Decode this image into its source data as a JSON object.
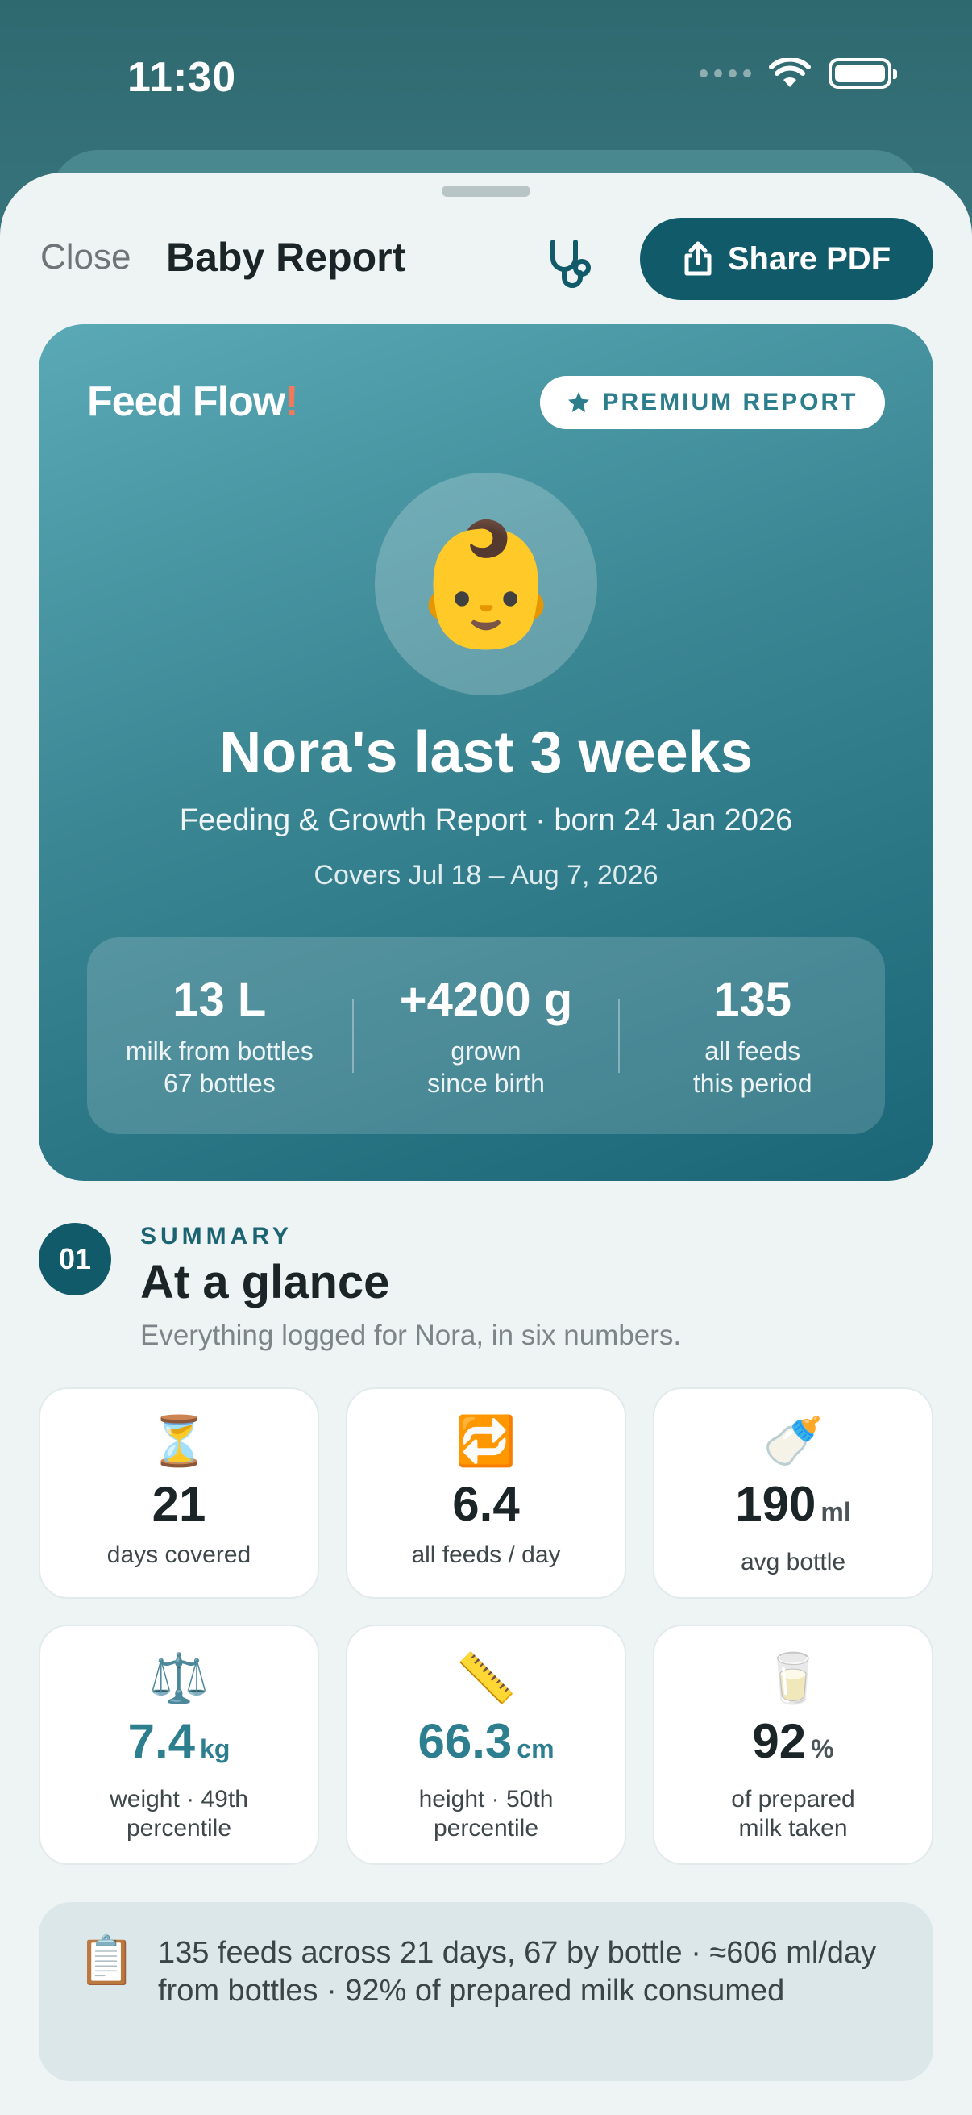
{
  "status_bar": {
    "time": "11:30"
  },
  "header": {
    "close_label": "Close",
    "title": "Baby Report",
    "share_label": "Share PDF"
  },
  "hero": {
    "brand": "Feed Flow",
    "brand_mark": "!",
    "badge": "PREMIUM REPORT",
    "avatar_emoji": "👶",
    "title": "Nora's last 3 weeks",
    "subtitle": "Feeding & Growth Report · born 24 Jan 2026",
    "covers": "Covers Jul 18 – Aug 7, 2026",
    "stats": [
      {
        "value": "13 L",
        "label_line1": "milk from bottles",
        "label_line2": "67 bottles"
      },
      {
        "value": "+4200 g",
        "label_line1": "grown",
        "label_line2": "since birth"
      },
      {
        "value": "135",
        "label_line1": "all feeds",
        "label_line2": "this period"
      }
    ]
  },
  "summary": {
    "number": "01",
    "kicker": "SUMMARY",
    "title": "At a glance",
    "subtitle": "Everything logged for Nora, in six numbers.",
    "cards": [
      {
        "icon": "⏳",
        "icon_name": "hourglass-icon",
        "value": "21",
        "unit": "",
        "label_line1": "days covered",
        "label_line2": ""
      },
      {
        "icon": "🔁",
        "icon_name": "repeat-icon",
        "value": "6.4",
        "unit": "",
        "label_line1": "all feeds / day",
        "label_line2": ""
      },
      {
        "icon": "🍼",
        "icon_name": "baby-bottle-icon",
        "value": "190",
        "unit": "ml",
        "label_line1": "avg bottle",
        "label_line2": ""
      },
      {
        "icon": "⚖️",
        "icon_name": "scale-icon",
        "value": "7.4",
        "unit": "kg",
        "label_line1": "weight · 49th",
        "label_line2": "percentile"
      },
      {
        "icon": "📏",
        "icon_name": "ruler-icon",
        "value": "66.3",
        "unit": "cm",
        "label_line1": "height · 50th",
        "label_line2": "percentile"
      },
      {
        "icon": "🥛",
        "icon_name": "milk-glass-icon",
        "value": "92",
        "unit": "%",
        "label_line1": "of prepared",
        "label_line2": "milk taken"
      }
    ]
  },
  "note": {
    "icon": "📋",
    "text": "135 feeds across 21 days, 67 by bottle · ≈606 ml/day from bottles · 92% of prepared milk consumed"
  },
  "colors": {
    "accent": "#115a6a",
    "teal_value": "#2d7f8f",
    "brand_mark": "#f07a5a"
  }
}
